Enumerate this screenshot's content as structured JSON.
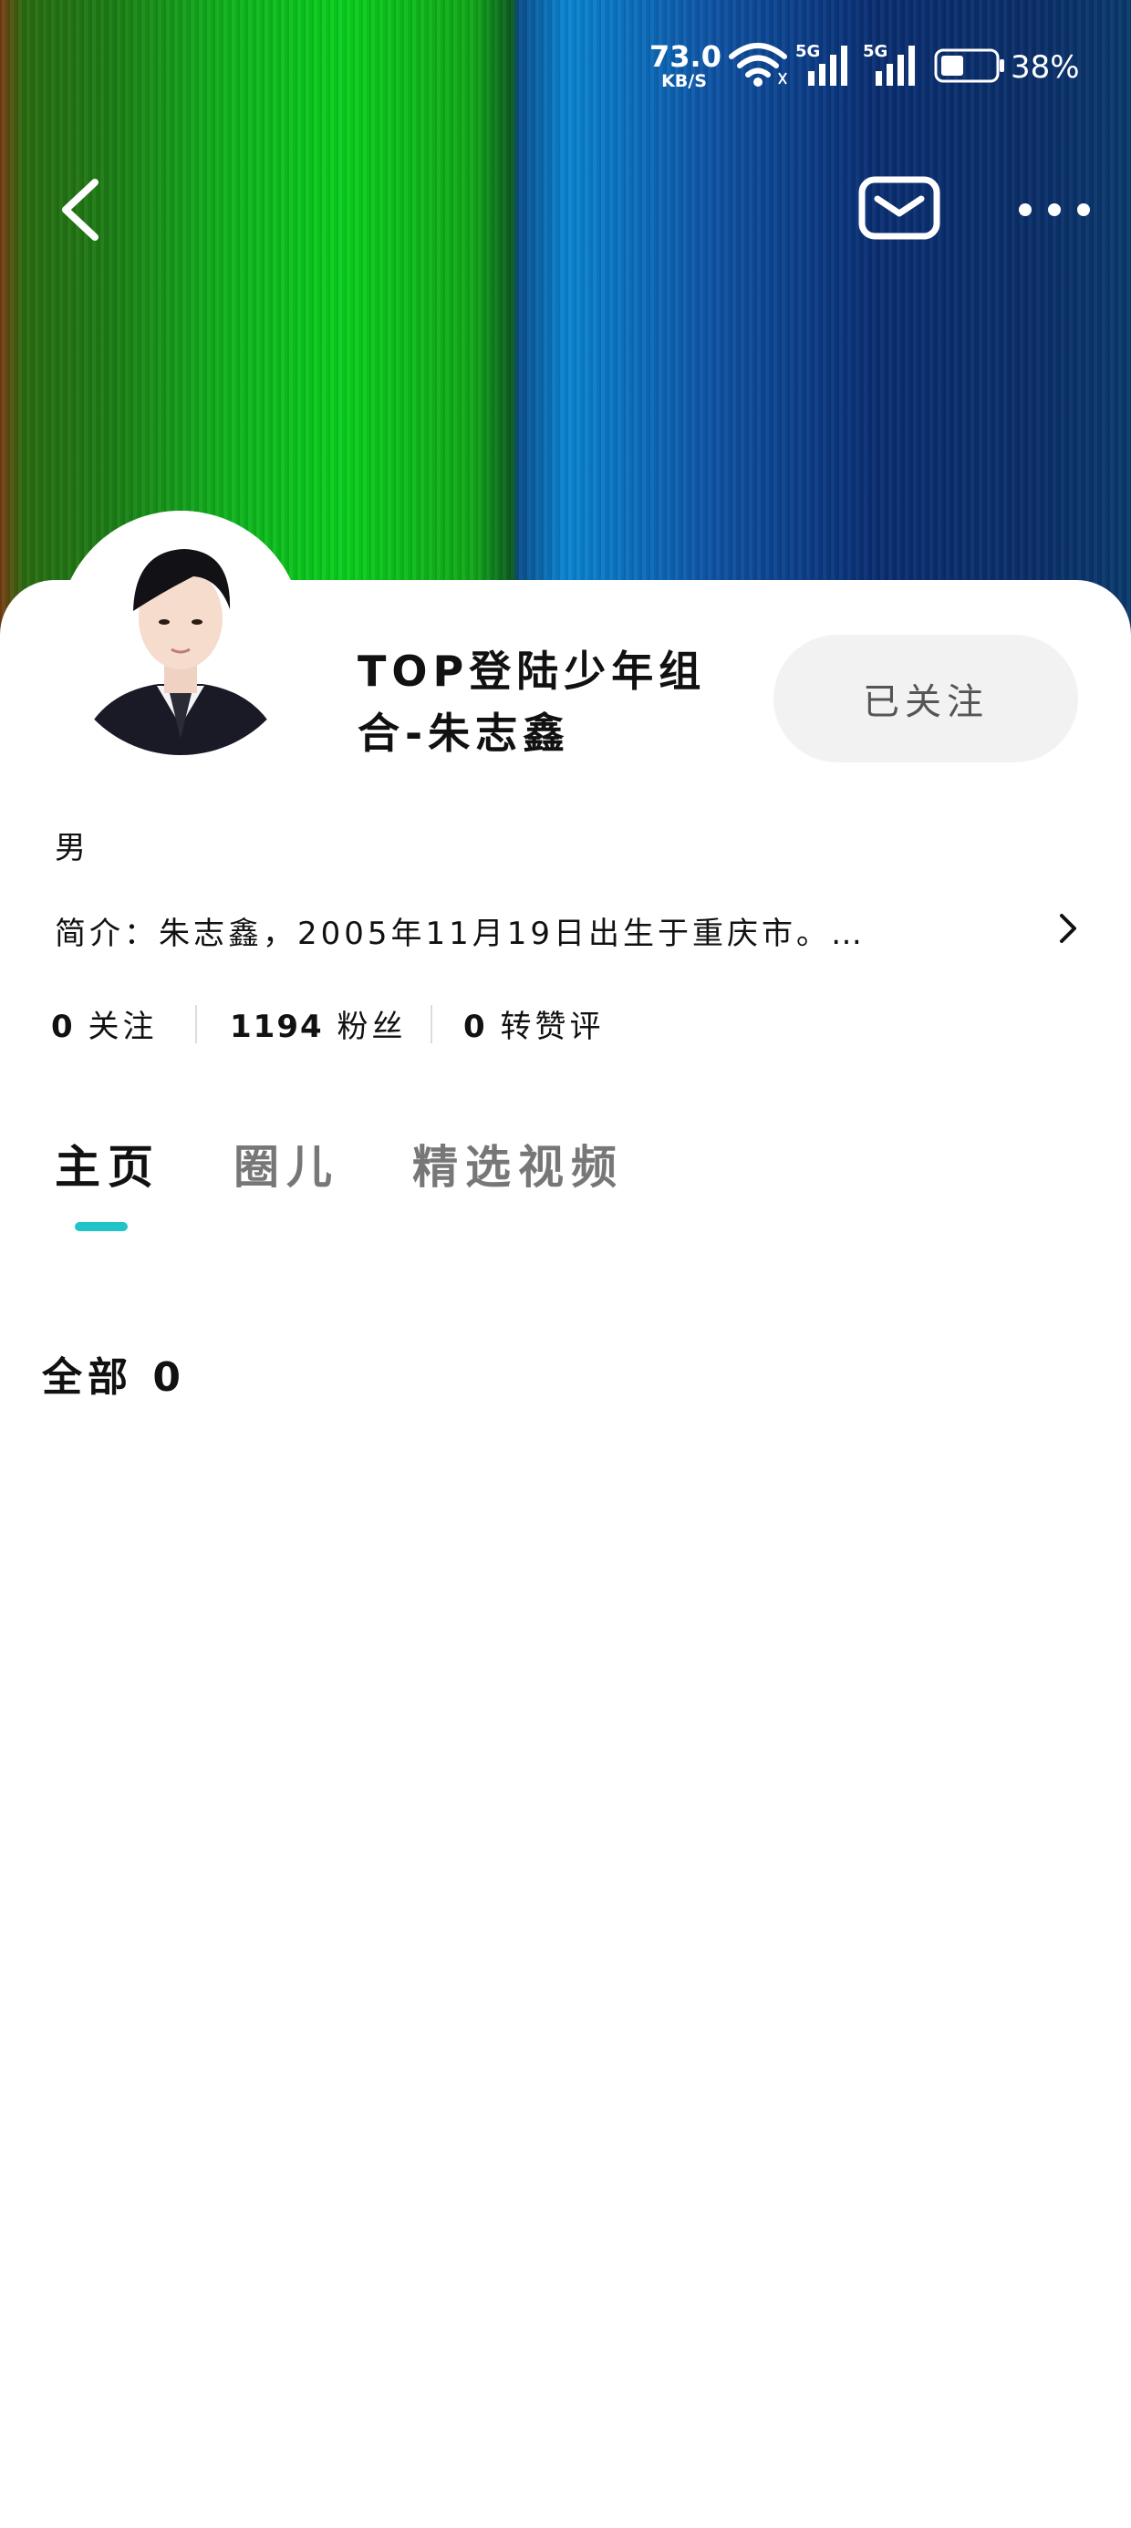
{
  "status_bar": {
    "net_speed_value": "73.0",
    "net_speed_unit": "KB/S",
    "signal_1_label": "5G",
    "signal_2_label": "5G",
    "battery_percent": "38%"
  },
  "colors": {
    "accent": "#1ec4c8",
    "follow_button_bg": "#f2f2f2"
  },
  "nav": {
    "back_icon": "chevron-left-icon",
    "mail_icon": "mail-icon",
    "more_icon": "more-horizontal-icon"
  },
  "profile": {
    "name": "TOP登陆少年组合-朱志鑫",
    "follow_button_label": "已关注",
    "gender": "男",
    "bio": "简介：朱志鑫，2005年11月19日出生于重庆市。…",
    "stats": [
      {
        "number": "0",
        "label": "关注"
      },
      {
        "number": "1194",
        "label": "粉丝"
      },
      {
        "number": "0",
        "label": "转赞评"
      }
    ]
  },
  "tabs": [
    {
      "label": "主页",
      "active": true
    },
    {
      "label": "圈儿",
      "active": false
    },
    {
      "label": "精选视频",
      "active": false
    }
  ],
  "content": {
    "section_title": "全部 0"
  }
}
